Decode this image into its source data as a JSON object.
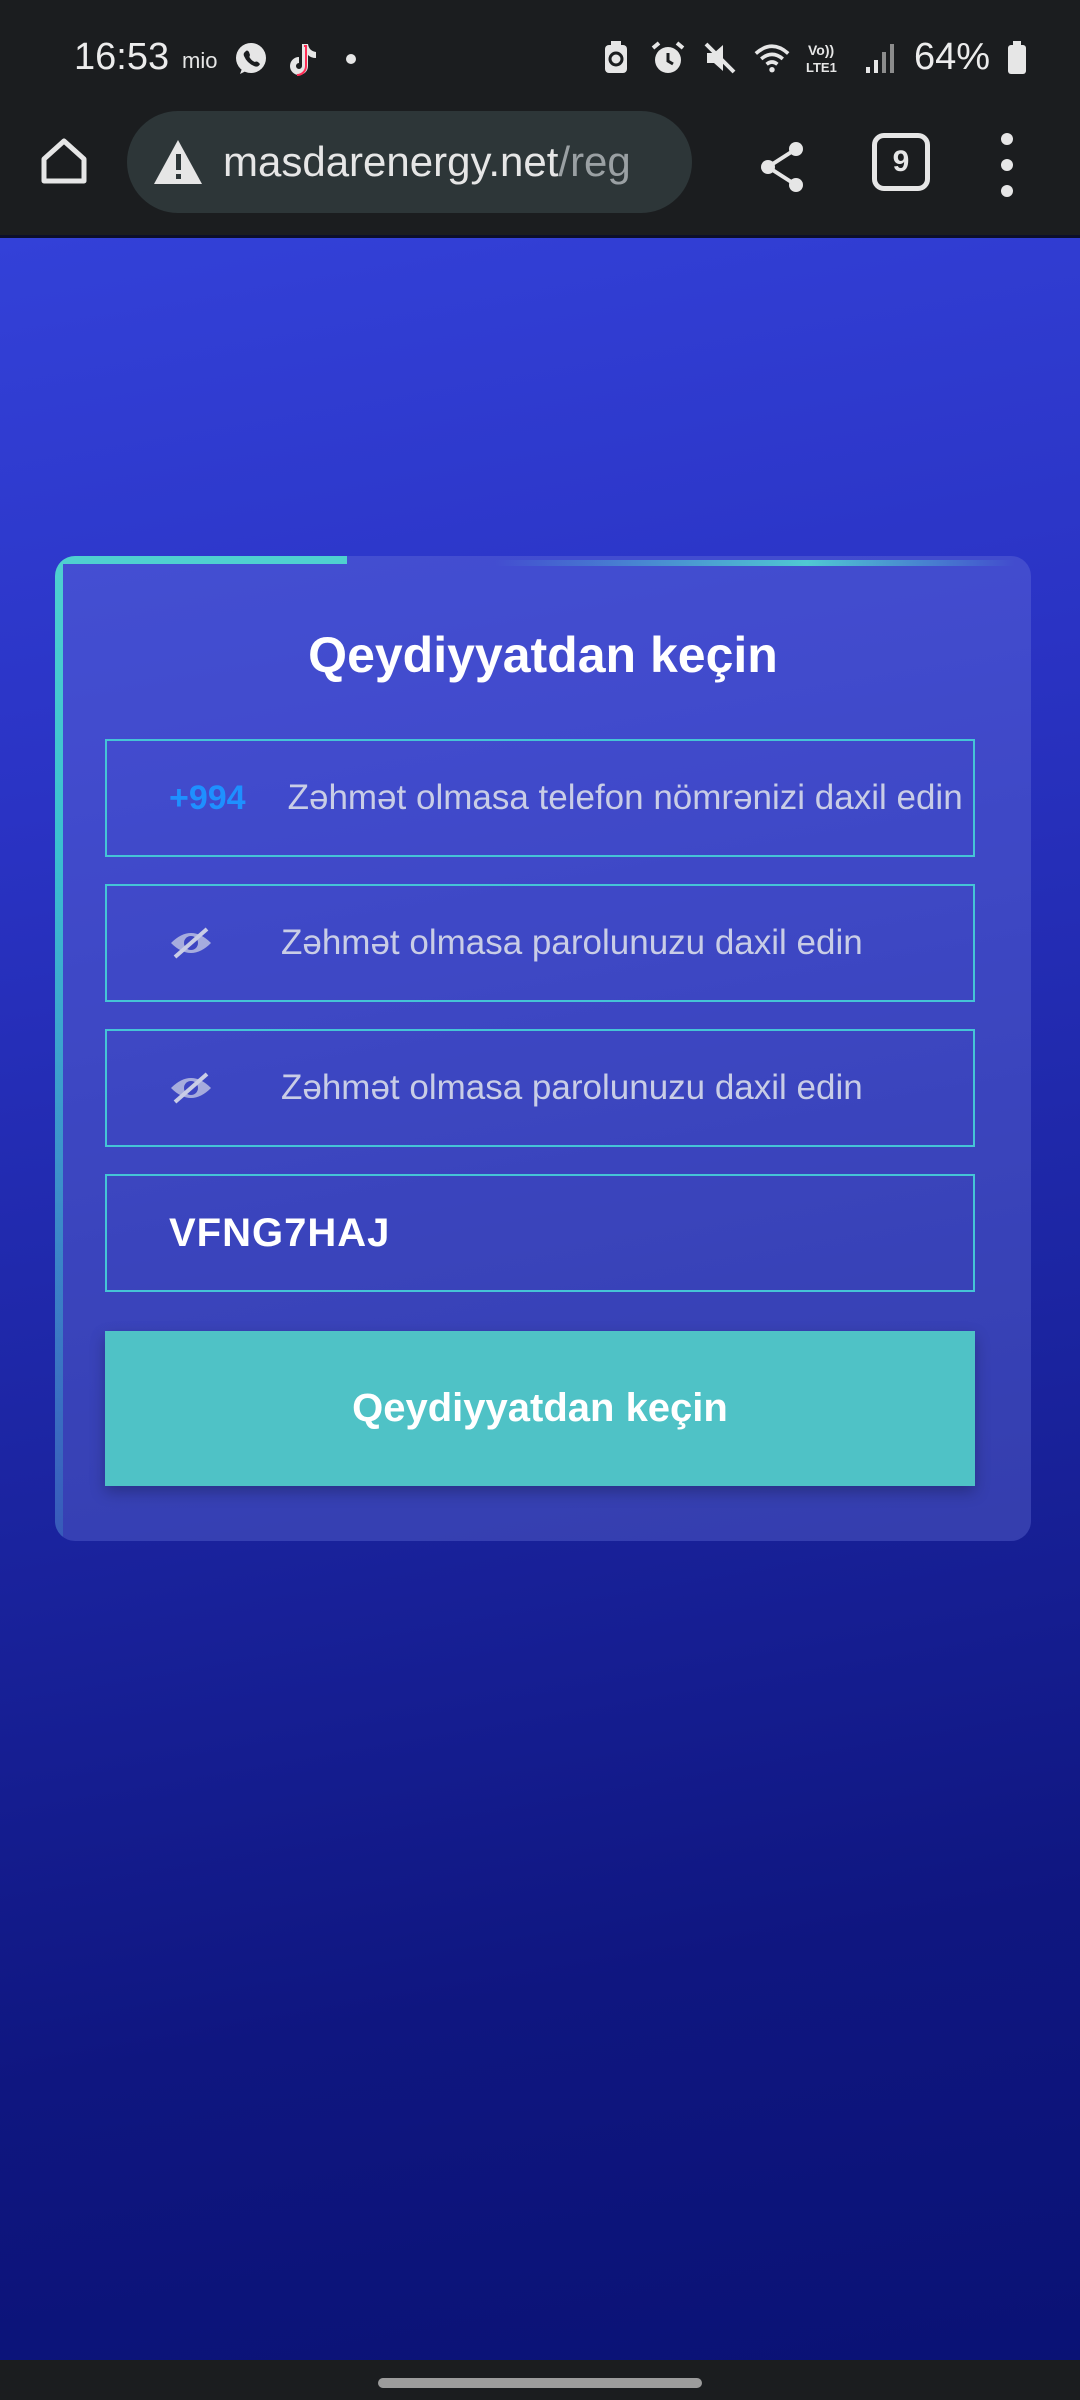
{
  "status_bar": {
    "time": "16:53",
    "left_icons": [
      "mio-icon",
      "whatsapp-icon",
      "tiktok-icon",
      "dot-icon"
    ],
    "right_icons": [
      "battery-saver-icon",
      "alarm-icon",
      "mute-icon",
      "wifi-icon",
      "volte-icon",
      "signal-icon"
    ],
    "volte_label": "Vo)) LTE1",
    "battery_percent": "64%"
  },
  "browser": {
    "url_domain": "masdarenergy.net",
    "url_path": "/reg",
    "tab_count": "9",
    "security_state": "not-secure"
  },
  "form": {
    "title": "Qeydiyyatdan keçin",
    "phone_prefix": "+994",
    "phone_placeholder": "Zəhmət olmasa telefon nömrənizi daxil edin",
    "password_placeholder": "Zəhmət olmasa parolunuzu daxil edin",
    "confirm_password_placeholder": "Zəhmət olmasa parolunuzu daxil edin",
    "invite_code": "VFNG7HAJ",
    "submit_label": "Qeydiyyatdan keçin"
  },
  "colors": {
    "accent": "#4fc2c6",
    "field_border": "#45c4d6",
    "phone_prefix": "#1e90ff",
    "background_top": "#3341d8",
    "background_bottom": "#0a1275"
  }
}
